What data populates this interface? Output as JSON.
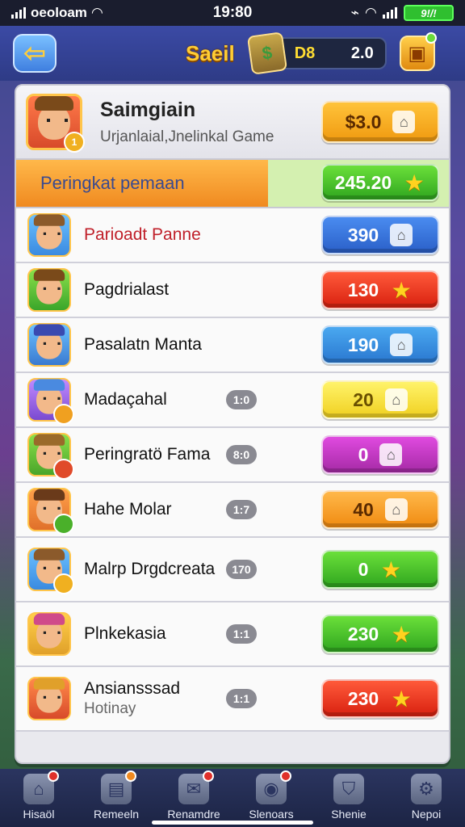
{
  "status_bar": {
    "carrier": "oeoloam",
    "time": "19:80",
    "battery": "9!/!"
  },
  "top_bar": {
    "title": "Saeil",
    "currency_code": "D8",
    "currency_amount": "2.0"
  },
  "header": {
    "name": "Saimgiain",
    "subtitle": "Urjanlaial,Jnelinkal Game",
    "value": "$3.0"
  },
  "ranking": {
    "label": "Peringkat pemaan",
    "value": "245.20"
  },
  "rows": [
    {
      "name": "Parioadt Panne",
      "level": "",
      "value": "390",
      "color": "blue",
      "icon": "home"
    },
    {
      "name": "Pagdrialast",
      "level": "",
      "value": "130",
      "color": "red",
      "icon": "star"
    },
    {
      "name": "Pasalatn Manta",
      "level": "",
      "value": "190",
      "color": "sky",
      "icon": "home"
    },
    {
      "name": "Madaçahal",
      "level": "1:0",
      "value": "20",
      "color": "yellow",
      "icon": "home"
    },
    {
      "name": "Peringratö Fama",
      "level": "8:0",
      "value": "0",
      "color": "magenta",
      "icon": "home"
    },
    {
      "name": "Hahe Molar",
      "level": "1:7",
      "value": "40",
      "color": "gold",
      "icon": "home"
    },
    {
      "name": "Malrp Drgdcreata",
      "level": "170",
      "value": "0",
      "color": "green",
      "icon": "star"
    },
    {
      "name": "Plnkekasia",
      "level": "1:1",
      "value": "230",
      "color": "green",
      "icon": "star"
    },
    {
      "name": "Ansiansssad",
      "sub": "Hotinay",
      "level": "1:1",
      "value": "230",
      "color": "red",
      "icon": "star"
    }
  ],
  "nav": [
    {
      "label": "Hisaöl"
    },
    {
      "label": "Remeeln"
    },
    {
      "label": "Renamdre"
    },
    {
      "label": "Slenoars"
    },
    {
      "label": "Shenie"
    },
    {
      "label": "Nepoi"
    }
  ],
  "colors": {
    "accent_gold": "#ffcc33",
    "panel": "#e9e9ee",
    "nav_bg": "#1c2444"
  }
}
